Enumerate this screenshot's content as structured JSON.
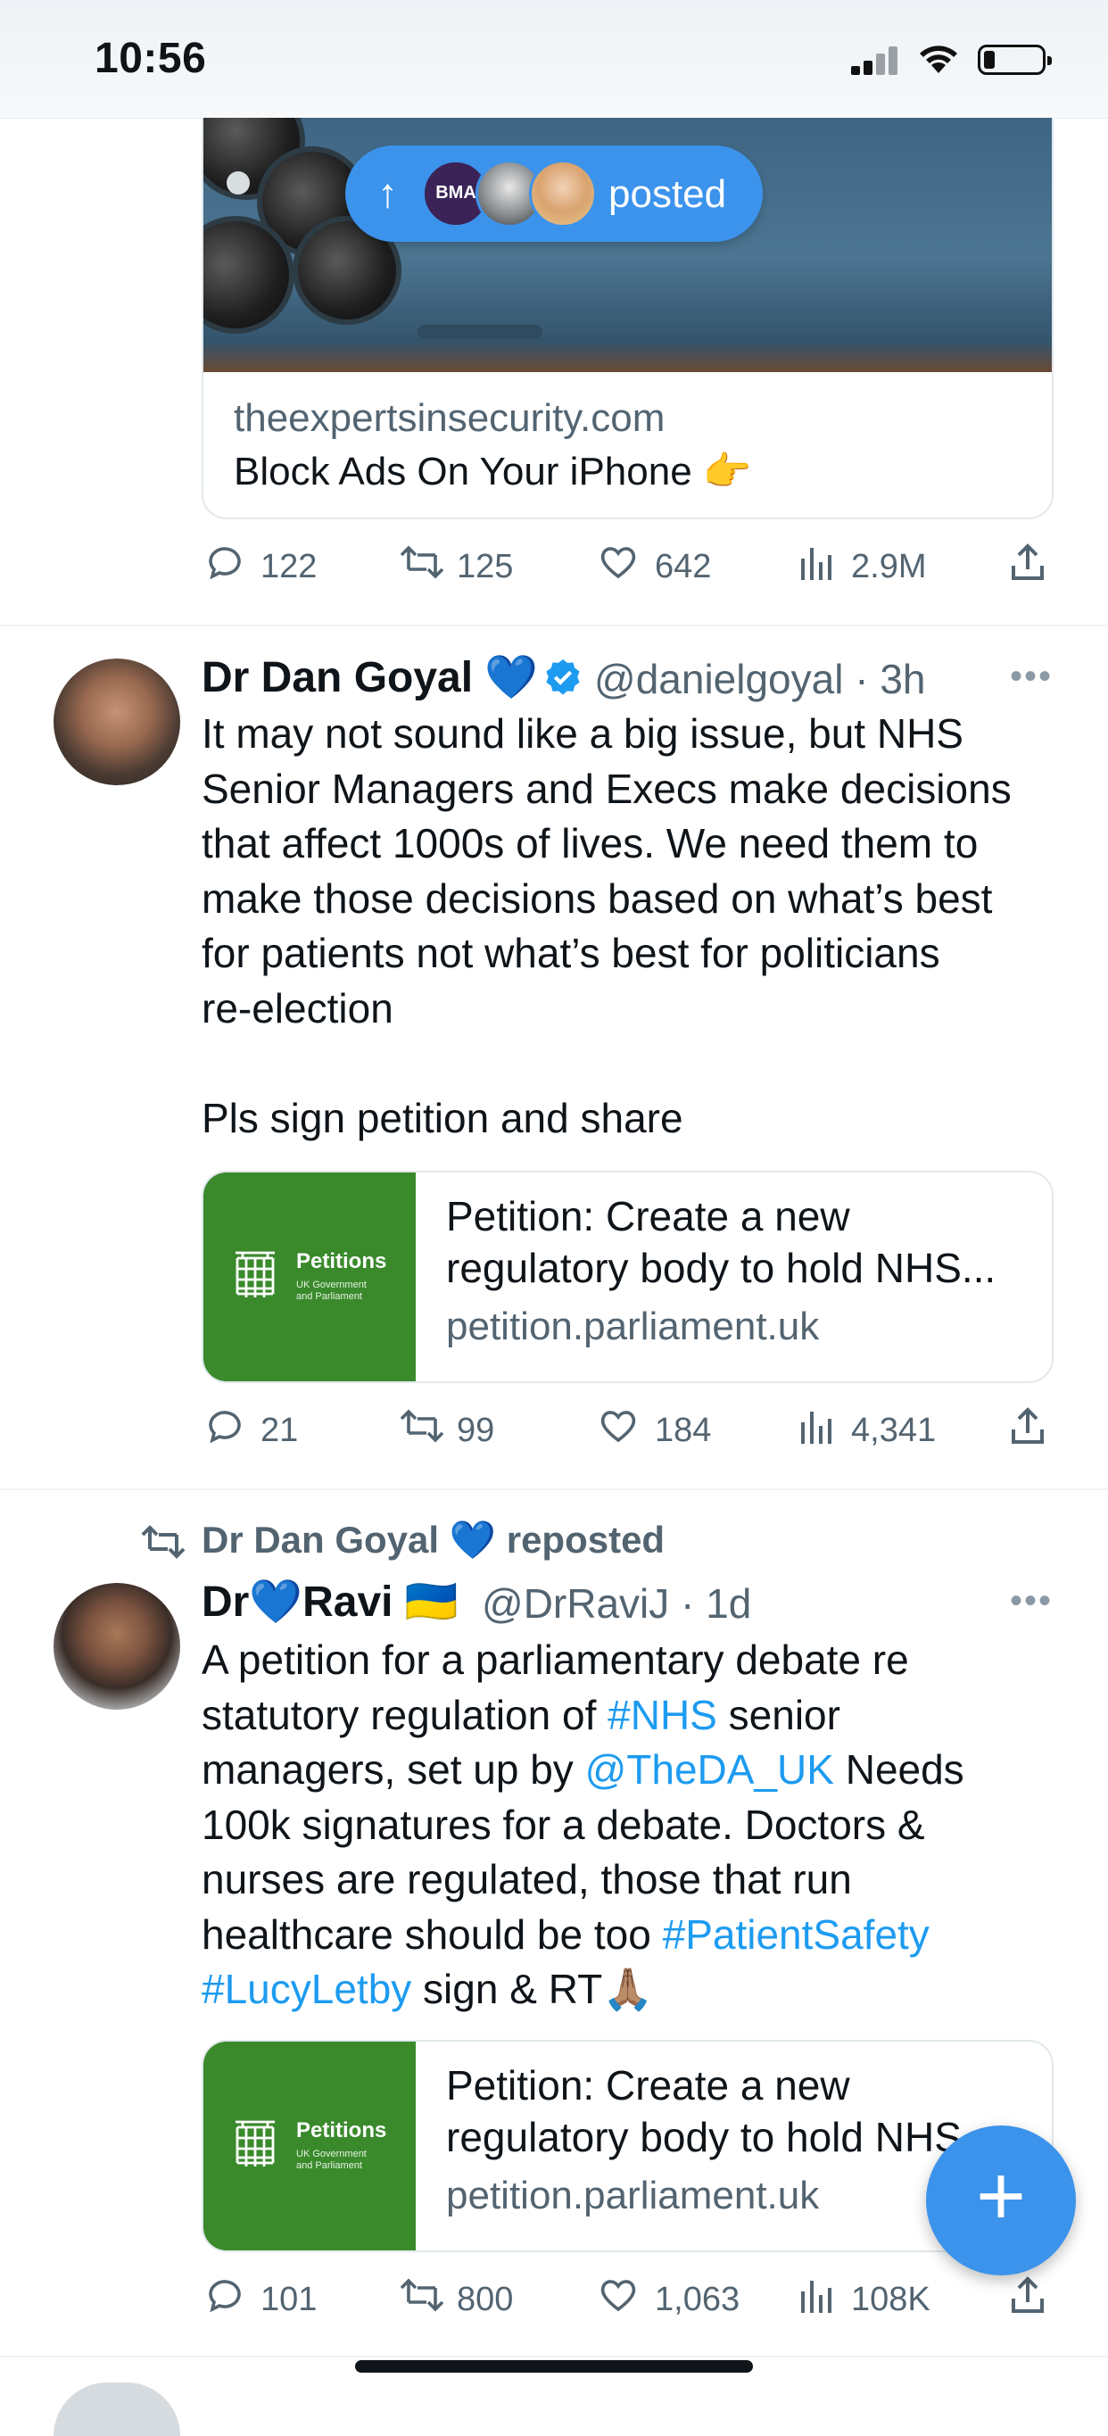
{
  "status_bar": {
    "time": "10:56"
  },
  "tweet_prev": {
    "card_domain": "theexpertsinsecurity.com",
    "card_title": "Block Ads On Your iPhone 👉",
    "posted_pill": {
      "bma_label": "BMA",
      "text": "posted"
    },
    "actions": {
      "replies": "122",
      "reposts": "125",
      "likes": "642",
      "views": "2.9M"
    }
  },
  "tweet_goyal": {
    "name": "Dr Dan Goyal",
    "name_emoji": "💙",
    "handle": "@danielgoyal",
    "time": "· 3h",
    "text_lines": [
      "It may not sound like a big issue, but NHS",
      "Senior Managers and Execs make decisions",
      "that affect 1000s of lives. We need them to",
      "make those decisions based on what’s best",
      "for patients not what’s best for politicians",
      "re-election",
      "",
      "Pls sign petition and share"
    ],
    "card": {
      "logo_title": "Petitions",
      "logo_sub1": "UK Government",
      "logo_sub2": "and Parliament",
      "title": "Petition: Create a new regulatory body to hold NHS...",
      "domain": "petition.parliament.uk"
    },
    "actions": {
      "replies": "21",
      "reposts": "99",
      "likes": "184",
      "views": "4,341"
    }
  },
  "tweet_ravi": {
    "reposted_by": "Dr Dan Goyal",
    "reposted_emoji": "💙",
    "reposted_label": "reposted",
    "name_part1": "Dr",
    "name_emoji": "💙",
    "name_part2": "Ravi",
    "flag": "🇺🇦",
    "handle": "@DrRaviJ",
    "time": "· 1d",
    "text": {
      "l1": "A petition for a parliamentary debate re",
      "l2a": "statutory regulation of ",
      "l2_tag": "#NHS",
      "l2b": " senior",
      "l3a": "managers, set up by ",
      "l3_mention": "@TheDA_UK",
      "l3b": " Needs",
      "l4": "100k signatures for a debate. Doctors &",
      "l5": "nurses are regulated, those that run",
      "l6a": "healthcare should be too ",
      "l6_tag": "#PatientSafety",
      "l7_tag": "#LucyLetby",
      "l7b": " sign & RT🙏🏽"
    },
    "card": {
      "logo_title": "Petitions",
      "logo_sub1": "UK Government",
      "logo_sub2": "and Parliament",
      "title": "Petition: Create a new regulatory body to hold NHS",
      "domain": "petition.parliament.uk"
    },
    "actions": {
      "replies": "101",
      "reposts": "800",
      "likes": "1,063",
      "views": "108K"
    }
  },
  "fab": {
    "icon": "plus-icon"
  },
  "colors": {
    "accent": "#1d9bf0",
    "fab": "#3b93ec",
    "petition_green": "#3a8a2c",
    "muted": "#536471"
  }
}
